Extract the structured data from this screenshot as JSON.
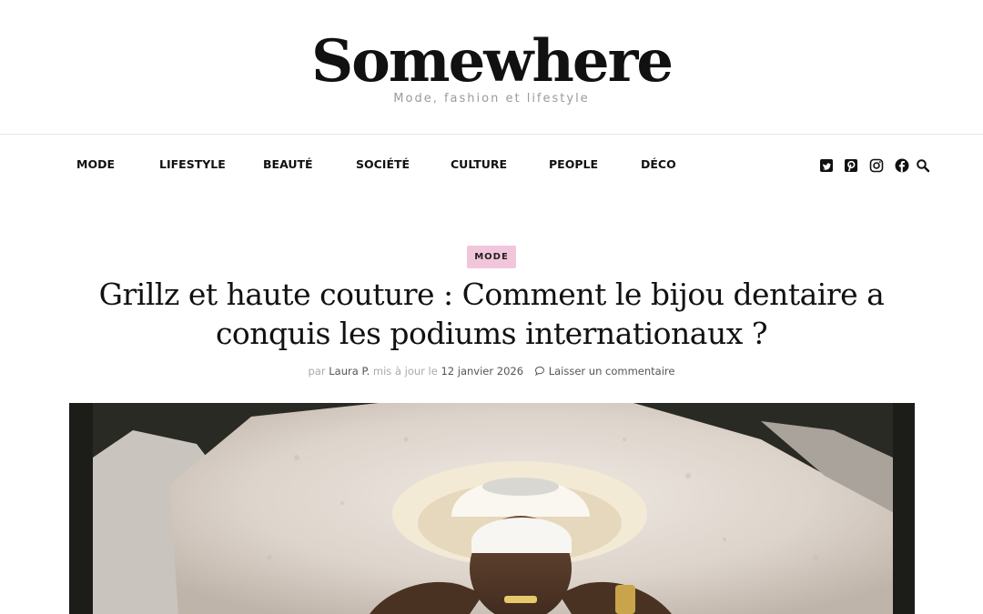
{
  "site": {
    "title": "Somewhere",
    "tagline": "Mode, fashion et lifestyle"
  },
  "nav": {
    "items": [
      "MODE",
      "LIFESTYLE",
      "BEAUTÉ",
      "SOCIÉTÉ",
      "CULTURE",
      "PEOPLE",
      "DÉCO"
    ],
    "social_icons": [
      "twitter-icon",
      "pinterest-icon",
      "instagram-icon",
      "facebook-icon",
      "search-icon"
    ]
  },
  "article": {
    "category": "MODE",
    "title": "Grillz et haute couture : Comment le bijou dentaire a conquis les podiums internationaux ?",
    "meta": {
      "by_prefix": "par",
      "author": "Laura P.",
      "updated_prefix": "mis à jour le",
      "date": "12 janvier 2026",
      "comment_label": "Laisser un commentaire"
    }
  },
  "colors": {
    "badge_bg": "#f2c6da",
    "text": "#111111",
    "muted": "#aaaaaa"
  }
}
